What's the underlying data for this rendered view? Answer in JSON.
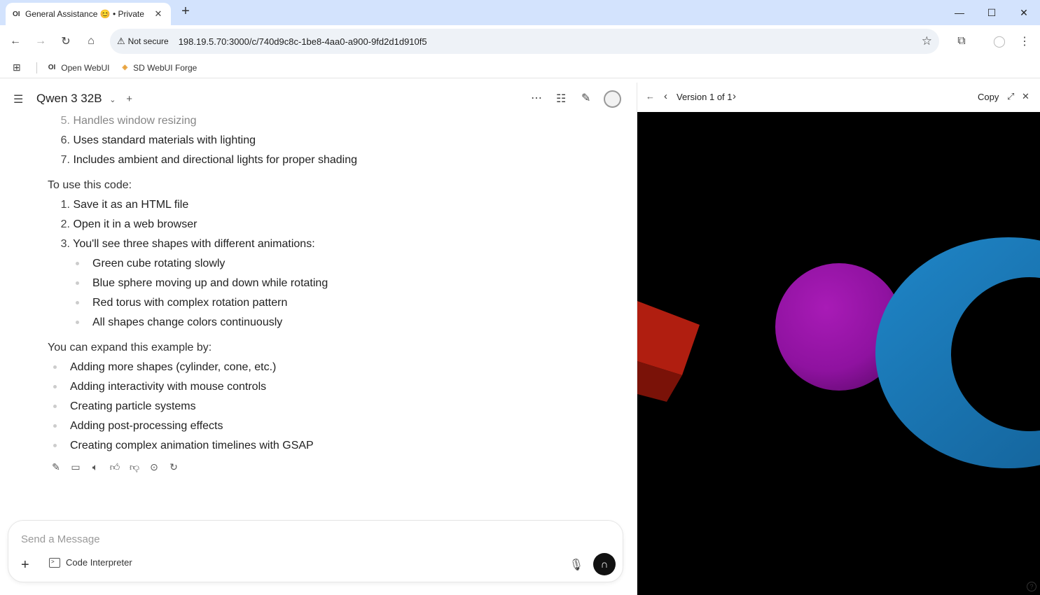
{
  "browser": {
    "tab_favicon": "OI",
    "tab_title": "General Assistance 😊 • Private",
    "not_secure": "Not secure",
    "url": "198.19.5.70:3000/c/740d9c8c-1be8-4aa0-a900-9fd2d1d910f5",
    "bookmarks": [
      {
        "icon": "OI",
        "label": "Open WebUI"
      },
      {
        "icon": "forge-icon",
        "label": "SD WebUI Forge"
      }
    ]
  },
  "chat": {
    "model_name": "Qwen 3 32B",
    "items_a": [
      {
        "num": "5.",
        "text": "Handles window resizing"
      },
      {
        "num": "6.",
        "text": "Uses standard materials with lighting"
      },
      {
        "num": "7.",
        "text": "Includes ambient and directional lights for proper shading"
      }
    ],
    "use_heading": "To use this code:",
    "items_b": [
      {
        "num": "1.",
        "text": "Save it as an HTML file"
      },
      {
        "num": "2.",
        "text": "Open it in a web browser"
      },
      {
        "num": "3.",
        "text": "You'll see three shapes with different animations:"
      }
    ],
    "subitems": [
      "Green cube rotating slowly",
      "Blue sphere moving up and down while rotating",
      "Red torus with complex rotation pattern",
      "All shapes change colors continuously"
    ],
    "expand_heading": "You can expand this example by:",
    "expand_items": [
      "Adding more shapes (cylinder, cone, etc.)",
      "Adding interactivity with mouse controls",
      "Creating particle systems",
      "Adding post-processing effects",
      "Creating complex animation timelines with GSAP"
    ],
    "input_placeholder": "Send a Message",
    "code_interpreter": "Code Interpreter"
  },
  "artifact": {
    "version_label": "Version 1 of 1",
    "copy_label": "Copy",
    "colors": {
      "cube": "#b01e10",
      "sphere": "#9a14a8",
      "torus": "#1b77b8"
    }
  }
}
